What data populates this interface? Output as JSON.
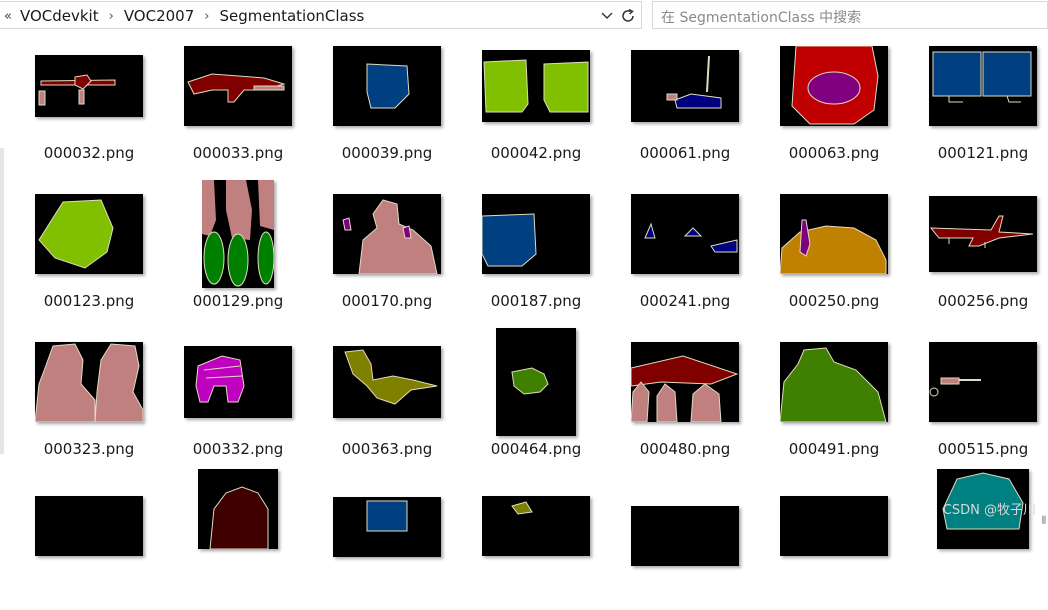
{
  "address": {
    "back_glyph": "«",
    "crumbs": [
      "VOCdevkit",
      "VOC2007",
      "SegmentationClass"
    ],
    "separator": "›",
    "dropdown_glyph": "⌄"
  },
  "search": {
    "placeholder": "在 SegmentationClass 中搜索"
  },
  "files": [
    "000032.png",
    "000033.png",
    "000039.png",
    "000042.png",
    "000061.png",
    "000063.png",
    "000121.png",
    "000123.png",
    "000129.png",
    "000170.png",
    "000187.png",
    "000241.png",
    "000250.png",
    "000256.png",
    "000323.png",
    "000332.png",
    "000363.png",
    "000464.png",
    "000480.png",
    "000491.png",
    "000515.png",
    "",
    "",
    "",
    "",
    "",
    "",
    ""
  ],
  "colors": {
    "outline": "#e0dcc0",
    "aeroplane": "#800000",
    "bicycle": "#008000",
    "bird": "#808000",
    "boat": "#000080",
    "bottle": "#800080",
    "chair": "#c00000",
    "person": "#c08080",
    "monitor": "#004080",
    "cat": "#3f0000",
    "lime": "#80c000",
    "orange": "#c08000",
    "dog": "#408000",
    "teal": "#008080"
  },
  "watermark": "CSDN @牧子川",
  "corner_mark": "⫼"
}
